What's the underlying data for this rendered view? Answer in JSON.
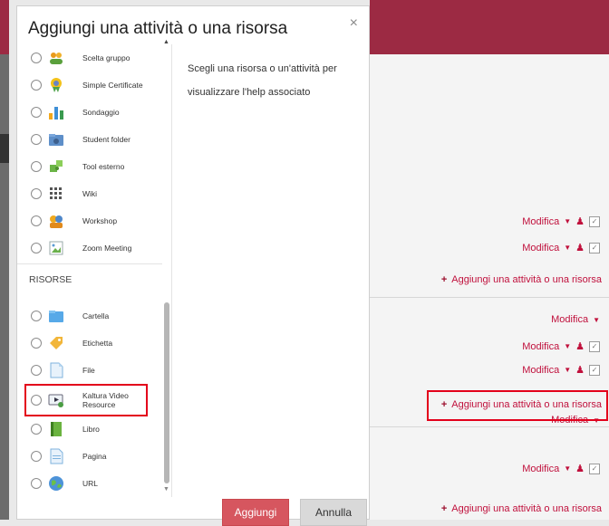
{
  "modal": {
    "title": "Aggiungi una attività o una risorsa",
    "close": "×",
    "help_text": "Scegli una risorsa o un'attività per visualizzare l'help associato",
    "section_risorse": "RISORSE",
    "activities": [
      {
        "label": "Scelta gruppo",
        "icon": "group-choice-icon"
      },
      {
        "label": "Simple Certificate",
        "icon": "certificate-icon"
      },
      {
        "label": "Sondaggio",
        "icon": "survey-icon"
      },
      {
        "label": "Student folder",
        "icon": "student-folder-icon"
      },
      {
        "label": "Tool esterno",
        "icon": "puzzle-icon"
      },
      {
        "label": "Wiki",
        "icon": "wiki-icon"
      },
      {
        "label": "Workshop",
        "icon": "workshop-icon"
      },
      {
        "label": "Zoom Meeting",
        "icon": "broken-image-icon"
      }
    ],
    "resources": [
      {
        "label": "Cartella",
        "icon": "folder-icon"
      },
      {
        "label": "Etichetta",
        "icon": "label-tag-icon"
      },
      {
        "label": "File",
        "icon": "file-icon"
      },
      {
        "label": "Kaltura Video Resource",
        "icon": "kaltura-video-icon"
      },
      {
        "label": "Libro",
        "icon": "book-icon"
      },
      {
        "label": "Pagina",
        "icon": "page-icon"
      },
      {
        "label": "URL",
        "icon": "url-globe-icon"
      }
    ],
    "add_button": "Aggiungi",
    "cancel_button": "Annulla"
  },
  "course": {
    "modifica": "Modifica",
    "add_activity": "Aggiungi una attività o una risorsa"
  },
  "colors": {
    "brand": "#9c2a43",
    "link": "#c0103c",
    "highlight": "#e3001b"
  }
}
